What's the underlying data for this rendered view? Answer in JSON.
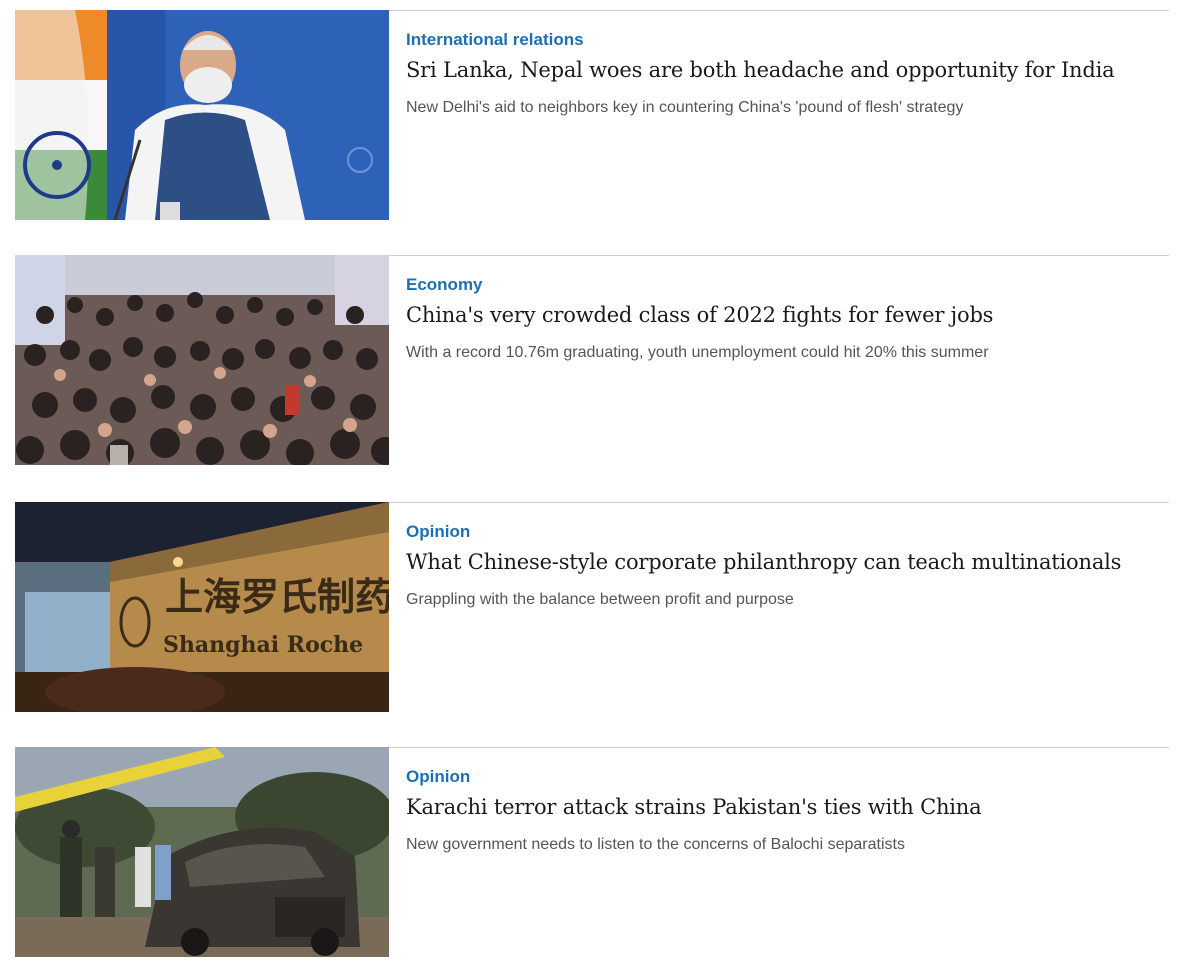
{
  "articles": [
    {
      "category": "International relations",
      "headline": "Sri Lanka, Nepal woes are both headache and opportunity for India",
      "summary": "New Delhi's aid to neighbors key in countering China's 'pound of flesh' strategy"
    },
    {
      "category": "Economy",
      "headline": "China's very crowded class of 2022 fights for fewer jobs",
      "summary": "With a record 10.76m graduating, youth unemployment could hit 20% this summer"
    },
    {
      "category": "Opinion",
      "headline": "What Chinese-style corporate philanthropy can teach multinationals",
      "summary": "Grappling with the balance between profit and purpose",
      "image_sign_text": "上海罗氏制药",
      "image_sign_latin": "Shanghai Roche"
    },
    {
      "category": "Opinion",
      "headline": "Karachi terror attack strains Pakistan's ties with China",
      "summary": "New government needs to listen to the concerns of Balochi separatists"
    }
  ],
  "colors": {
    "category": "#1d6fb3",
    "headline": "#1a1a1a",
    "summary": "#555555",
    "divider": "#cfcfcf"
  }
}
